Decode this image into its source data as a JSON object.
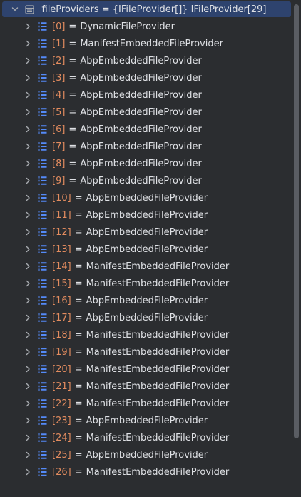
{
  "root": {
    "label": "_fileProviders = {IFileProvider[]} IFileProvider[29]"
  },
  "items": [
    {
      "index": "[0]",
      "value": "DynamicFileProvider"
    },
    {
      "index": "[1]",
      "value": "ManifestEmbeddedFileProvider"
    },
    {
      "index": "[2]",
      "value": "AbpEmbeddedFileProvider"
    },
    {
      "index": "[3]",
      "value": "AbpEmbeddedFileProvider"
    },
    {
      "index": "[4]",
      "value": "AbpEmbeddedFileProvider"
    },
    {
      "index": "[5]",
      "value": "AbpEmbeddedFileProvider"
    },
    {
      "index": "[6]",
      "value": "AbpEmbeddedFileProvider"
    },
    {
      "index": "[7]",
      "value": "AbpEmbeddedFileProvider"
    },
    {
      "index": "[8]",
      "value": "AbpEmbeddedFileProvider"
    },
    {
      "index": "[9]",
      "value": "AbpEmbeddedFileProvider"
    },
    {
      "index": "[10]",
      "value": "AbpEmbeddedFileProvider"
    },
    {
      "index": "[11]",
      "value": "AbpEmbeddedFileProvider"
    },
    {
      "index": "[12]",
      "value": "AbpEmbeddedFileProvider"
    },
    {
      "index": "[13]",
      "value": "AbpEmbeddedFileProvider"
    },
    {
      "index": "[14]",
      "value": "ManifestEmbeddedFileProvider"
    },
    {
      "index": "[15]",
      "value": "ManifestEmbeddedFileProvider"
    },
    {
      "index": "[16]",
      "value": "AbpEmbeddedFileProvider"
    },
    {
      "index": "[17]",
      "value": "AbpEmbeddedFileProvider"
    },
    {
      "index": "[18]",
      "value": "ManifestEmbeddedFileProvider"
    },
    {
      "index": "[19]",
      "value": "ManifestEmbeddedFileProvider"
    },
    {
      "index": "[20]",
      "value": "ManifestEmbeddedFileProvider"
    },
    {
      "index": "[21]",
      "value": "ManifestEmbeddedFileProvider"
    },
    {
      "index": "[22]",
      "value": "ManifestEmbeddedFileProvider"
    },
    {
      "index": "[23]",
      "value": "AbpEmbeddedFileProvider"
    },
    {
      "index": "[24]",
      "value": "ManifestEmbeddedFileProvider"
    },
    {
      "index": "[25]",
      "value": "AbpEmbeddedFileProvider"
    },
    {
      "index": "[26]",
      "value": "ManifestEmbeddedFileProvider"
    }
  ],
  "icons": {
    "expanded": "chevron-down-icon",
    "collapsed": "chevron-right-icon",
    "root_type": "object-icon",
    "item_type": "list-icon"
  },
  "colors": {
    "background": "#2b2d30",
    "selection": "#2e436e",
    "index": "#e38c5f",
    "text": "#dfe1e5",
    "chevron": "#a8abb0",
    "list_icon": "#548af7"
  }
}
